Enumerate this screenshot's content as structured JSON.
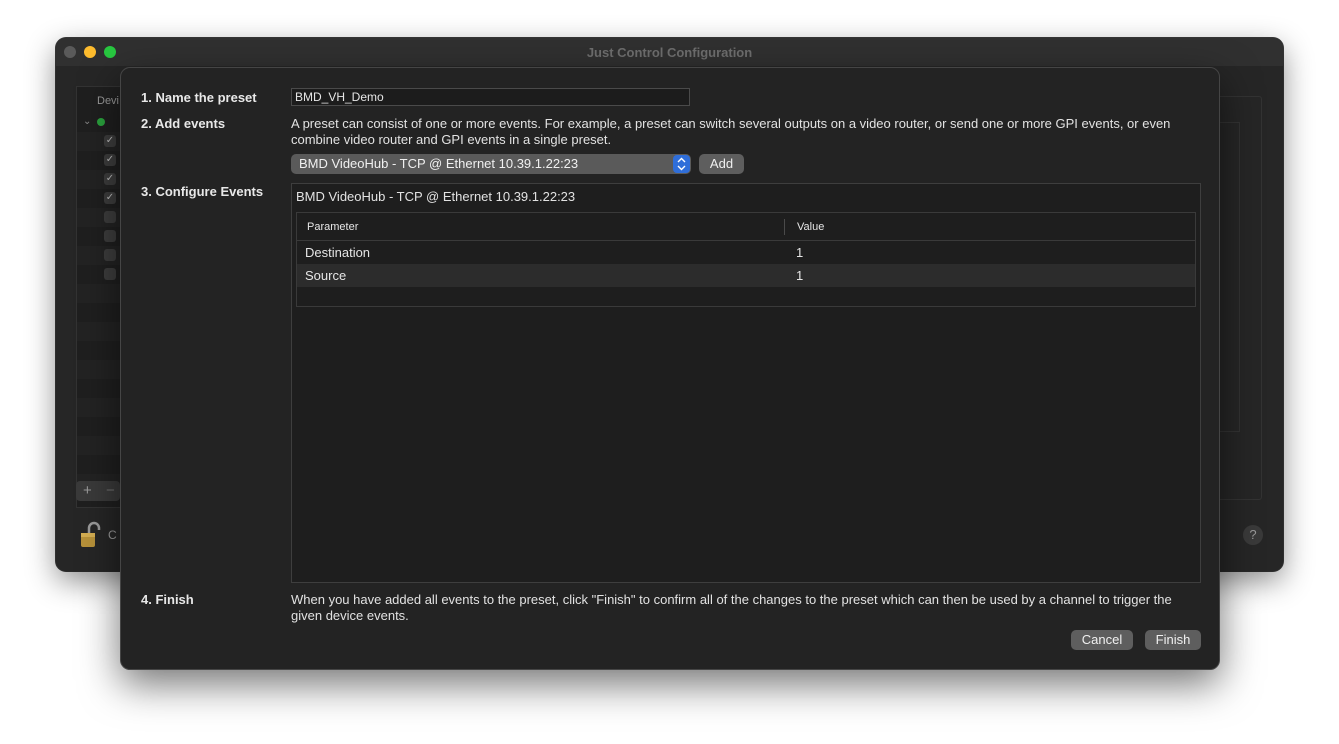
{
  "window": {
    "title": "Just Control Configuration"
  },
  "devices": {
    "header": "Devi",
    "disclosure": "⌄",
    "check": "✓",
    "lock_label": "C",
    "add_label": "+",
    "remove_label": "−",
    "help_label": "?"
  },
  "sheet": {
    "step1": {
      "label": "1. Name the preset",
      "value": "BMD_VH_Demo"
    },
    "step2": {
      "label": "2. Add events",
      "description": "A preset can consist of one or more events. For example, a preset can switch several outputs on a video router, or send one or more GPI events, or even combine video router and GPI events in a single preset.",
      "selected_device": "BMD VideoHub - TCP @ Ethernet 10.39.1.22:23",
      "add_button": "Add"
    },
    "step3": {
      "label": "3. Configure Events",
      "event_title": "BMD VideoHub - TCP @ Ethernet 10.39.1.22:23",
      "columns": [
        "Parameter",
        "Value"
      ],
      "rows": [
        {
          "parameter": "Destination",
          "value": "1"
        },
        {
          "parameter": "Source",
          "value": "1"
        }
      ]
    },
    "step4": {
      "label": "4. Finish",
      "description": "When you have added all events to the preset, click \"Finish\" to confirm all of the changes to the preset which can then be used by a channel to trigger the given device events."
    },
    "buttons": {
      "cancel": "Cancel",
      "finish": "Finish"
    }
  },
  "colors": {
    "accent": "#2f6ed9",
    "status_green": "#2aa13d",
    "traffic_yellow": "#febc2e",
    "traffic_green": "#28c840"
  }
}
